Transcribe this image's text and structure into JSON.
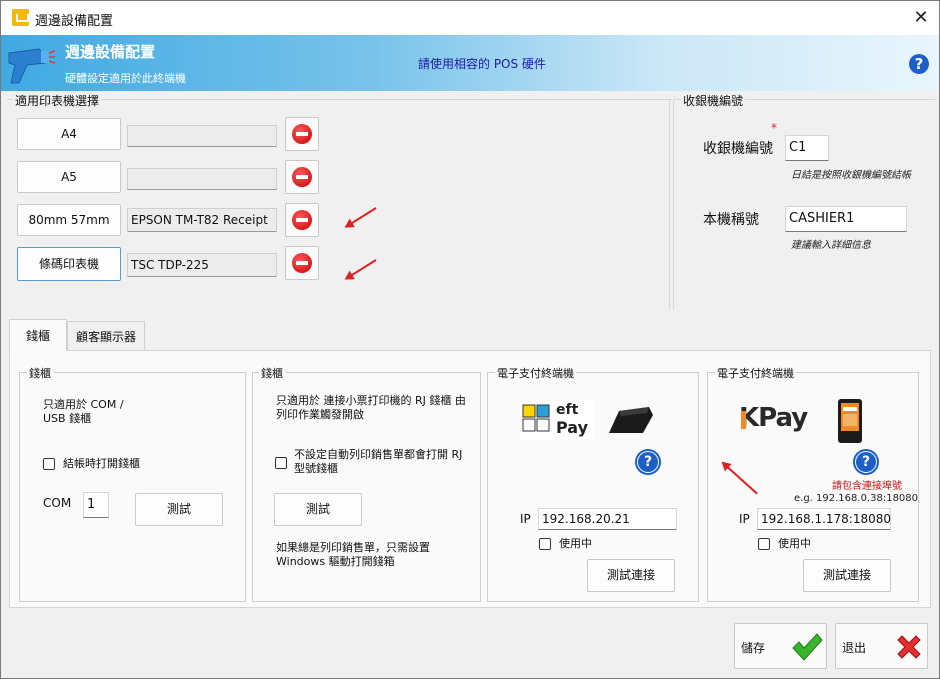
{
  "window": {
    "title": "週邊設備配置",
    "close_label": "✕"
  },
  "banner": {
    "title": "週邊設備配置",
    "subtitle": "硬體設定適用於此終端機",
    "note": "請使用相容的 POS 硬件",
    "help_label": "?"
  },
  "printers": {
    "group_label": "適用印表機選擇",
    "rows": [
      {
        "button": "A4",
        "value": ""
      },
      {
        "button": "A5",
        "value": ""
      },
      {
        "button": "80mm 57mm",
        "value": "EPSON TM-T82 Receipt"
      },
      {
        "button": "條碼印表機",
        "value": "TSC TDP-225"
      }
    ]
  },
  "cashier": {
    "group_label": "收銀機編號",
    "required_mark": "*",
    "number_label": "收銀機編號",
    "number_value": "C1",
    "number_hint": "日結是按照收銀機編號結帳",
    "name_label": "本機稱號",
    "name_value": "CASHIER1",
    "name_hint": "建議輸入詳細信息"
  },
  "tabs": [
    {
      "label": "錢櫃"
    },
    {
      "label": "顧客顯示器"
    }
  ],
  "drawer_com": {
    "label": "錢櫃",
    "desc": "只適用於 COM / USB 錢櫃",
    "checkbox_label": "結帳時打開錢櫃",
    "com_label": "COM",
    "com_value": "1",
    "test_label": "測試"
  },
  "drawer_rj": {
    "label": "錢櫃",
    "desc": "只適用於 連接小票打印機的 RJ 錢櫃 由列印作業觸發開啟",
    "checkbox_label": "不設定自動列印銷售單都會打開 RJ 型號錢櫃",
    "test_label": "測試",
    "note": "如果總是列印銷售單，只需設置 Windows 驅動打開錢箱"
  },
  "eftpay": {
    "label": "電子支付終端機",
    "logo_text_1": "eft",
    "logo_text_2": "Pay",
    "help_label": "?",
    "ip_label": "IP",
    "ip_value": "192.168.20.21",
    "in_use_label": "使用中",
    "test_label": "測試連接"
  },
  "kpay": {
    "label": "電子支付終端機",
    "logo_text": "KPay",
    "help_label": "?",
    "warning": "請包含連接埠號",
    "example": "e.g. 192.168.0.38:18080",
    "ip_label": "IP",
    "ip_value": "192.168.1.178:18080",
    "in_use_label": "使用中",
    "test_label": "測試連接"
  },
  "footer": {
    "save_label": "儲存",
    "exit_label": "退出"
  },
  "colors": {
    "banner_start": "#3fa9e2",
    "link_blue": "#1a1aa8",
    "danger_red": "#e02020",
    "ok_green": "#38b52a"
  }
}
